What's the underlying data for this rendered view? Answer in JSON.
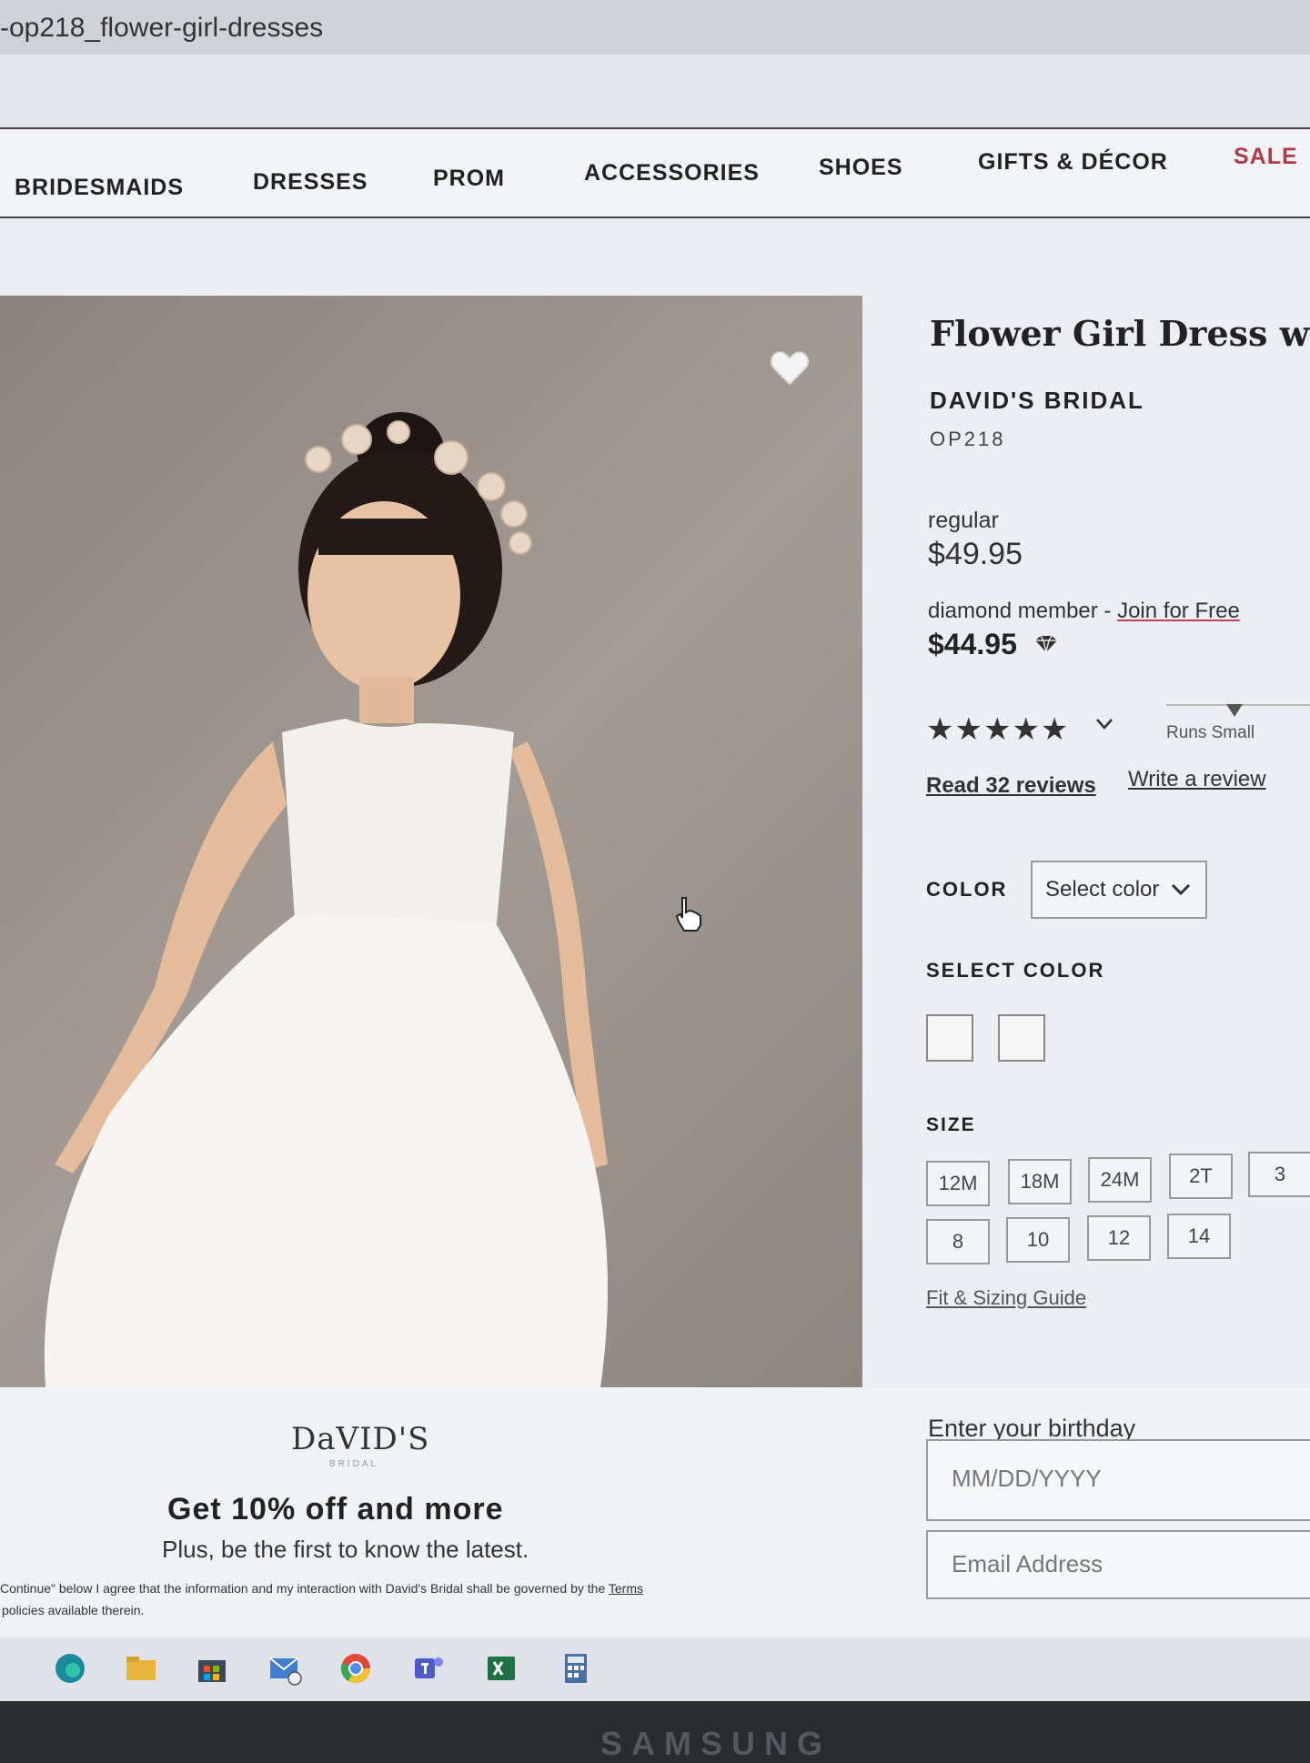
{
  "browser": {
    "url_fragment": "-op218_flower-girl-dresses"
  },
  "nav": {
    "items": [
      "BRIDESMAIDS",
      "DRESSES",
      "PROM",
      "ACCESSORIES",
      "SHOES",
      "GIFTS & DÉCOR",
      "SALE"
    ]
  },
  "product": {
    "title": "Flower Girl Dress with",
    "brand": "DAVID'S BRIDAL",
    "sku": "OP218",
    "regular_label": "regular",
    "regular_price": "$49.95",
    "member_prefix": "diamond member - ",
    "member_link": "Join for Free",
    "member_price": "$44.95",
    "rating_stars": "★★★★★",
    "fit_label": "Runs Small",
    "read_reviews": "Read 32 reviews",
    "write_review": "Write a review",
    "color_label": "COLOR",
    "color_select": "Select color",
    "select_color_label": "SELECT COLOR",
    "size_label": "SIZE",
    "sizes_row1": [
      "12M",
      "18M",
      "24M",
      "2T",
      "3"
    ],
    "sizes_row2": [
      "8",
      "10",
      "12",
      "14"
    ],
    "fit_guide": "Fit & Sizing Guide"
  },
  "signup": {
    "logo": "DaVID'S",
    "logo_sub": "BRIDAL",
    "title": "Get 10% off and more",
    "subtitle": "Plus, be the first to know the latest.",
    "legal_line1": "Continue\" below I agree that the information and my interaction with David's Bridal shall be governed by the ",
    "legal_link": "Terms",
    "legal_line2": "policies available therein.",
    "birthday_label": "Enter your birthday",
    "birthday_placeholder": "MM/DD/YYYY",
    "email_placeholder": "Email Address"
  },
  "taskbar": {
    "icons": [
      "edge-icon",
      "file-explorer-icon",
      "store-icon",
      "mail-icon",
      "chrome-icon",
      "teams-icon",
      "excel-icon",
      "calculator-icon"
    ]
  },
  "monitor_brand": "SAMSUNG",
  "colors": {
    "sale": "#b23a4a",
    "link_underline": "#c4405a"
  }
}
